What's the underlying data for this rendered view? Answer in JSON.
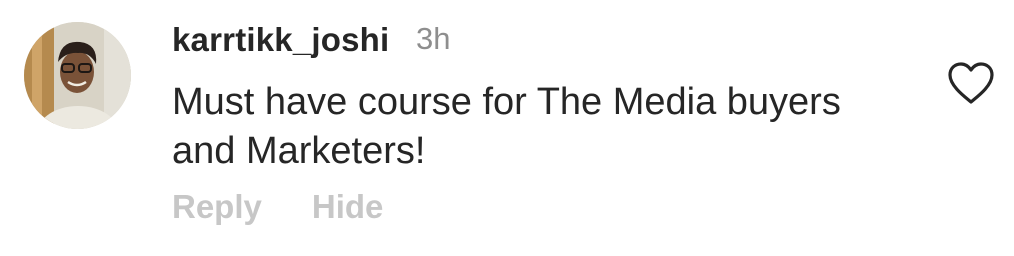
{
  "comment": {
    "username": "karrtikk_joshi",
    "timestamp": "3h",
    "text": "Must have course for The Media buyers and Marketers!",
    "actions": {
      "reply_label": "Reply",
      "hide_label": "Hide"
    },
    "like_icon": "heart-outline-icon"
  }
}
